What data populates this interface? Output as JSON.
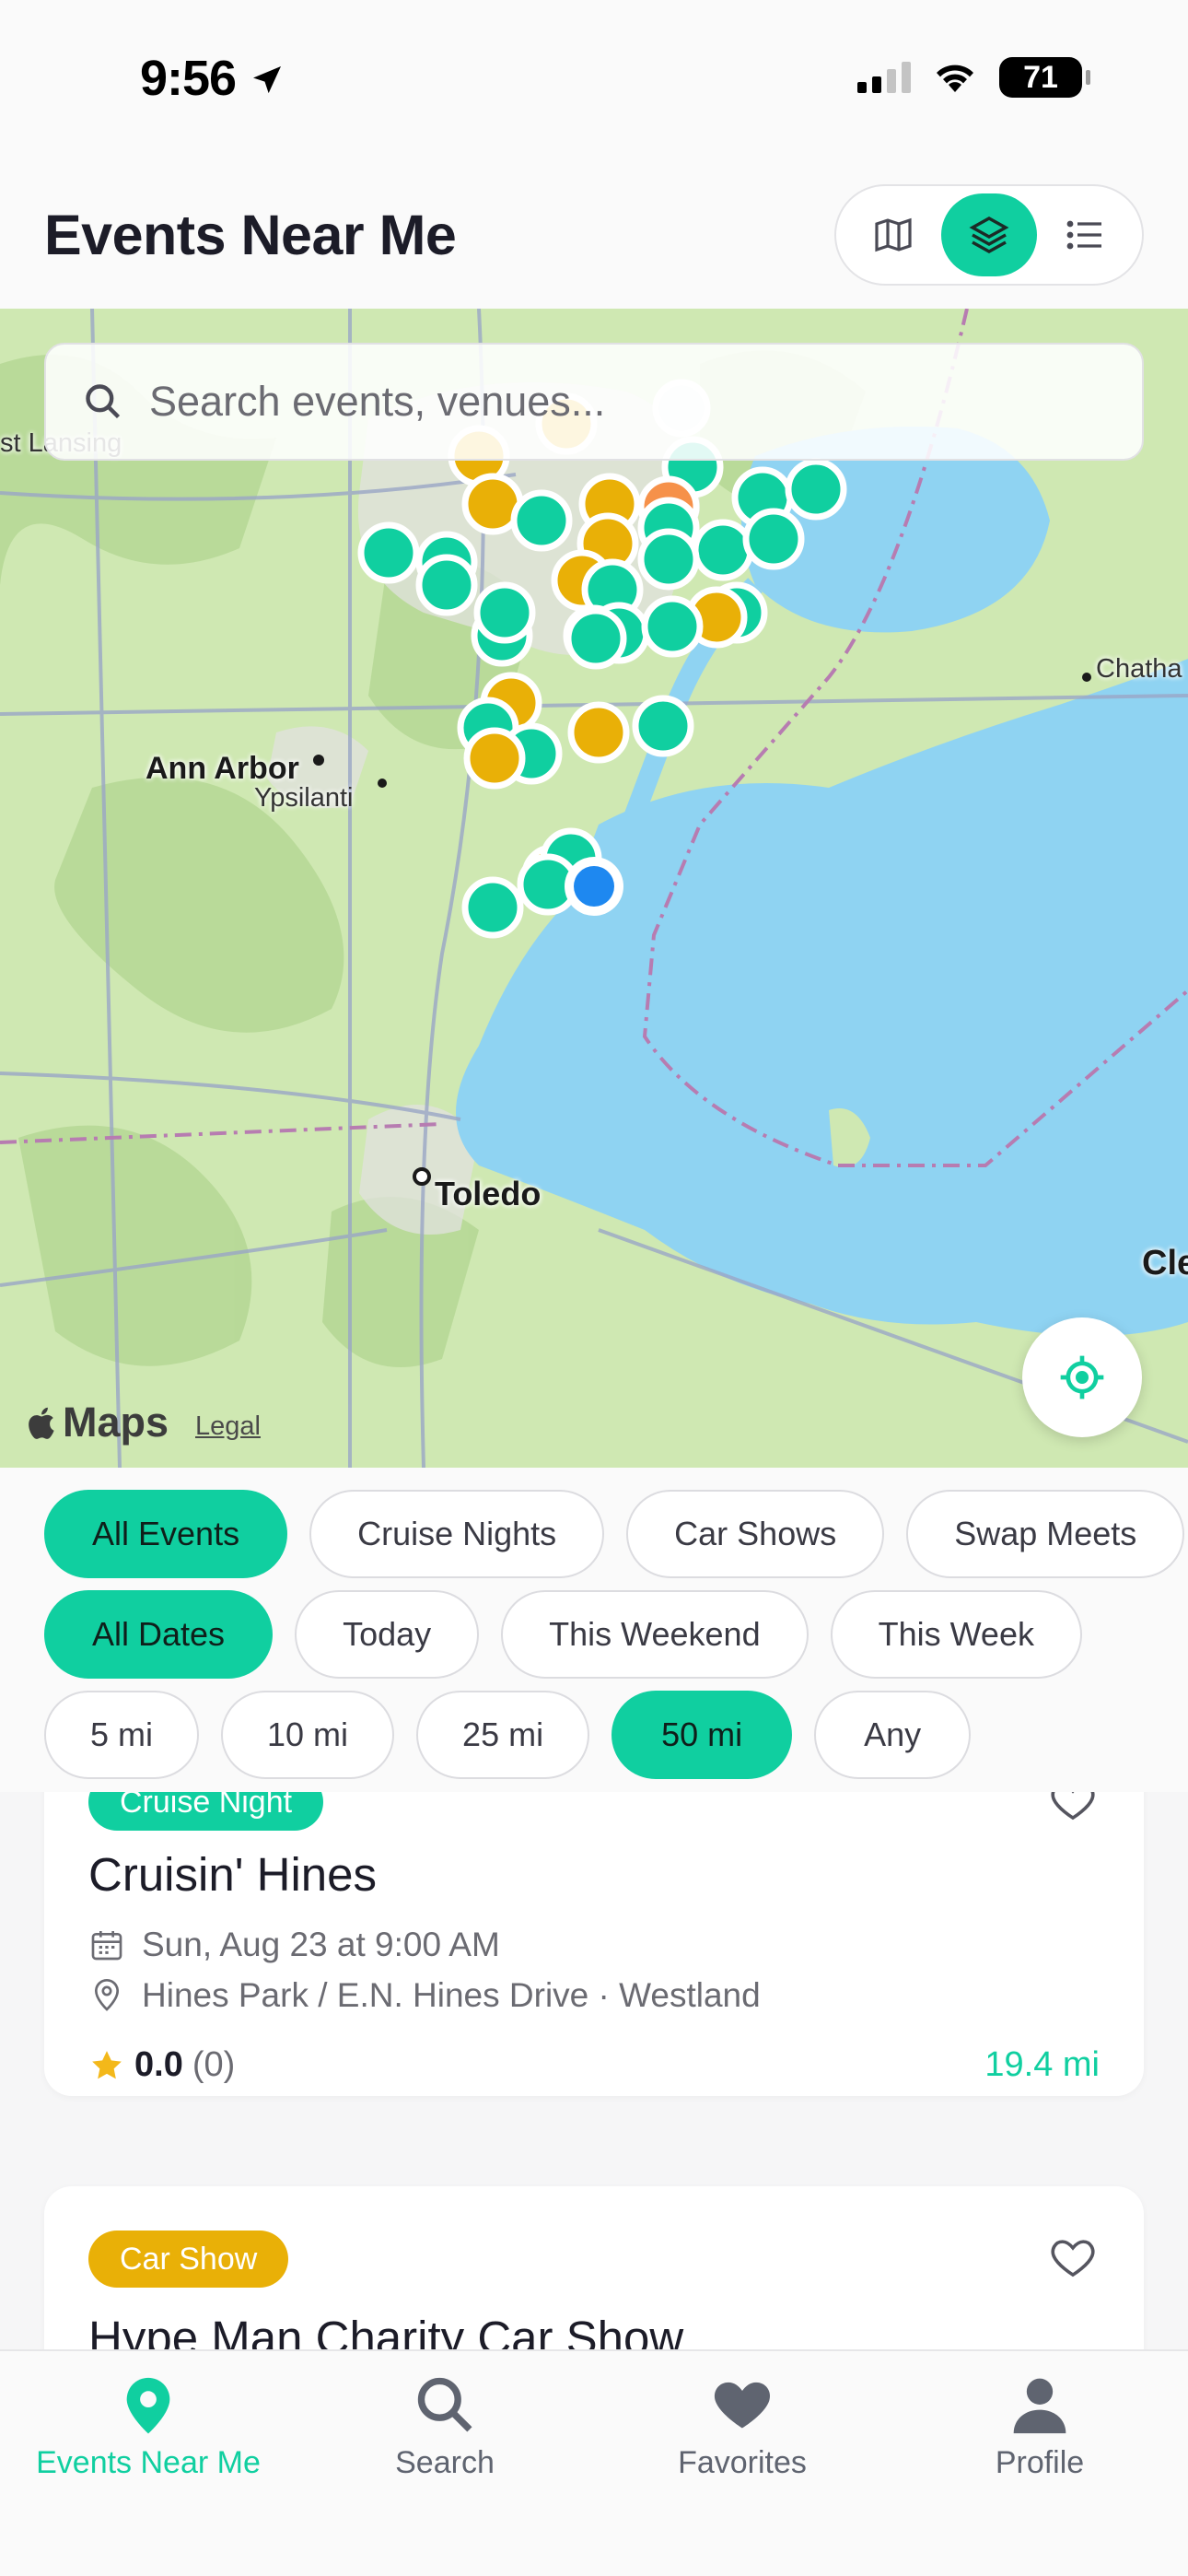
{
  "status": {
    "time": "9:56",
    "battery": "71"
  },
  "header": {
    "title": "Events Near Me"
  },
  "view_toggle": {
    "options": [
      "map-icon",
      "layers-icon",
      "list-icon"
    ],
    "active": "layers-icon"
  },
  "search": {
    "placeholder": "Search events, venues..."
  },
  "map": {
    "labels": {
      "lansing": "st Lansing",
      "ann_arbor": "Ann Arbor",
      "ypsilanti": "Ypsilanti",
      "toledo": "Toledo",
      "chatham": "Chatha",
      "cleveland": "Cle"
    },
    "brand": "Maps",
    "legal": "Legal"
  },
  "filters": {
    "categories": [
      "All Events",
      "Cruise Nights",
      "Car Shows",
      "Swap Meets"
    ],
    "dates": [
      "All Dates",
      "Today",
      "This Weekend",
      "This Week"
    ],
    "distances": [
      "5 mi",
      "10 mi",
      "25 mi",
      "50 mi",
      "Any"
    ]
  },
  "events": [
    {
      "badge": "Cruise Night",
      "title": "Cruisin' Hines",
      "date": "Sun, Aug 23 at 9:00 AM",
      "location": "Hines Park / E.N. Hines Drive · Westland",
      "rating": "0.0",
      "rating_count": "(0)",
      "distance": "19.4 mi"
    },
    {
      "badge": "Car Show",
      "title": "Hype Man Charity Car Show"
    }
  ],
  "tabs": [
    "Events Near Me",
    "Search",
    "Favorites",
    "Profile"
  ],
  "colors": {
    "accent": "#10cfa0",
    "car_show": "#e9b007",
    "water": "#8fd3f2",
    "land": "#cfe8b2"
  }
}
